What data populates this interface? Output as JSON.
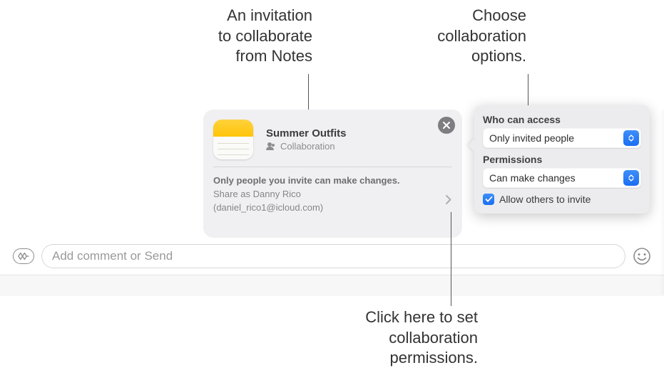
{
  "callouts": {
    "invite": "An invitation\nto collaborate\nfrom Notes",
    "options": "Choose\ncollaboration\noptions.",
    "permissions": "Click here to set\ncollaboration\npermissions."
  },
  "card": {
    "title": "Summer Outfits",
    "subtitle": "Collaboration",
    "body_line1": "Only people you invite can make changes.",
    "body_line2": "Share as Danny Rico",
    "body_line3": "(daniel_rico1@icloud.com)"
  },
  "popover": {
    "access_label": "Who can access",
    "access_value": "Only invited people",
    "perm_label": "Permissions",
    "perm_value": "Can make changes",
    "allow_label": "Allow others to invite",
    "allow_checked": true
  },
  "compose": {
    "placeholder": "Add comment or Send"
  }
}
